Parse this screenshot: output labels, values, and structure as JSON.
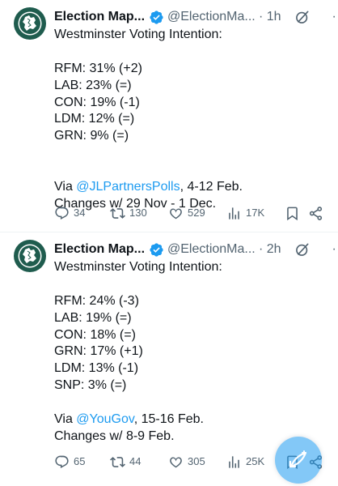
{
  "tweets": [
    {
      "author_name": "Election Map...",
      "handle": "@ElectionMa...",
      "separator_time": "· 1h",
      "more_label": "···",
      "lines": [
        "Westminster Voting Intention:",
        "",
        "RFM: 31% (+2)",
        "LAB: 23% (=)",
        "CON: 19% (-1)",
        "LDM: 12% (=)",
        "GRN: 9% (=)",
        "",
        ""
      ],
      "via_prefix": "Via ",
      "mention": "@JLPartnersPolls",
      "via_suffix": ", 4-12 Feb.",
      "changes": "Changes w/ 29 Nov - 1 Dec.",
      "replies": "34",
      "reposts": "130",
      "likes": "529",
      "views": "17K"
    },
    {
      "author_name": "Election Map...",
      "handle": "@ElectionMa...",
      "separator_time": "· 2h",
      "more_label": "···",
      "lines": [
        "Westminster Voting Intention:",
        "",
        "RFM: 24% (-3)",
        "LAB: 19% (=)",
        "CON: 18% (=)",
        "GRN: 17% (+1)",
        "LDM: 13% (-1)",
        "SNP: 3% (=)",
        ""
      ],
      "via_prefix": "Via ",
      "mention": "@YouGov",
      "via_suffix": ", 15-16 Feb.",
      "changes": "Changes w/ 8-9 Feb.",
      "replies": "65",
      "reposts": "44",
      "likes": "305",
      "views": "25K"
    }
  ],
  "colors": {
    "text": "#0f1419",
    "secondary": "#536471",
    "link": "#1d9bf0",
    "verified": "#1d9bf0",
    "avatar_green": "#1f5c4e"
  },
  "icons": {
    "avatar": "election-maps-logo-icon",
    "verified": "verified-badge-icon",
    "grok": "grok-icon",
    "reply": "reply-icon",
    "repost": "repost-icon",
    "like": "heart-icon",
    "views": "views-chart-icon",
    "bookmark": "bookmark-icon",
    "share": "share-icon",
    "compose": "compose-post-icon"
  }
}
